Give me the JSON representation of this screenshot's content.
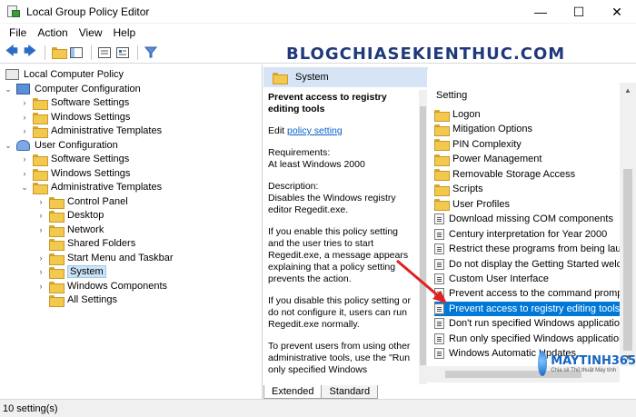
{
  "window": {
    "title": "Local Group Policy Editor",
    "minimize_glyph": "—",
    "maximize_glyph": "☐",
    "close_glyph": "✕"
  },
  "menu": [
    "File",
    "Action",
    "View",
    "Help"
  ],
  "toolbar_icons": [
    "back-arrow-icon",
    "forward-arrow-icon",
    "folder-up-icon",
    "show-hide-tree-icon",
    "export-list-icon",
    "properties-icon",
    "filter-icon"
  ],
  "tree": {
    "root": "Local Computer Policy",
    "computer_config": "Computer Configuration",
    "cc_software": "Software Settings",
    "cc_windows": "Windows Settings",
    "cc_admin": "Administrative Templates",
    "user_config": "User Configuration",
    "uc_software": "Software Settings",
    "uc_windows": "Windows Settings",
    "uc_admin": "Administrative Templates",
    "control_panel": "Control Panel",
    "desktop": "Desktop",
    "network": "Network",
    "shared_folders": "Shared Folders",
    "start_menu": "Start Menu and Taskbar",
    "system": "System",
    "windows_components": "Windows Components",
    "all_settings": "All Settings"
  },
  "details": {
    "header": "System",
    "policy_title": "Prevent access to registry editing tools",
    "edit_prefix": "Edit",
    "edit_link": "policy setting",
    "requirements_label": "Requirements:",
    "requirements_value": "At least Windows 2000",
    "description_label": "Description:",
    "description_value": "Disables the Windows registry editor Regedit.exe.",
    "para_enable": "If you enable this policy setting and the user tries to start Regedit.exe, a message appears explaining that a policy setting prevents the action.",
    "para_disable": "If you disable this policy setting or do not configure it, users can run Regedit.exe normally.",
    "para_prevent": "To prevent users from using other administrative tools, use the \"Run only specified Windows"
  },
  "list": {
    "column_header": "Setting",
    "rows": [
      {
        "label": "Logon",
        "kind": "folder"
      },
      {
        "label": "Mitigation Options",
        "kind": "folder"
      },
      {
        "label": "PIN Complexity",
        "kind": "folder"
      },
      {
        "label": "Power Management",
        "kind": "folder"
      },
      {
        "label": "Removable Storage Access",
        "kind": "folder"
      },
      {
        "label": "Scripts",
        "kind": "folder"
      },
      {
        "label": "User Profiles",
        "kind": "folder"
      },
      {
        "label": "Download missing COM components",
        "kind": "setting"
      },
      {
        "label": "Century interpretation for Year 2000",
        "kind": "setting"
      },
      {
        "label": "Restrict these programs from being launched",
        "kind": "setting"
      },
      {
        "label": "Do not display the Getting Started welcome screen",
        "kind": "setting"
      },
      {
        "label": "Custom User Interface",
        "kind": "setting"
      },
      {
        "label": "Prevent access to the command prompt",
        "kind": "setting"
      },
      {
        "label": "Prevent access to registry editing tools",
        "kind": "setting",
        "selected": true
      },
      {
        "label": "Don't run specified Windows applications",
        "kind": "setting"
      },
      {
        "label": "Run only specified Windows applications",
        "kind": "setting"
      },
      {
        "label": "Windows Automatic Updates",
        "kind": "setting"
      }
    ]
  },
  "tabs": [
    "Extended",
    "Standard"
  ],
  "status": "10 setting(s)",
  "watermark": "BLOGCHIASEKIENTHUC.COM",
  "logo": {
    "name": "MAYTINH365",
    "tagline": "Chia sẻ Thủ thuật Máy tính"
  },
  "colors": {
    "selection": "#0078d7",
    "header_band": "#d6e4f5",
    "annotation": "#e02020",
    "link": "#0a62c9"
  }
}
